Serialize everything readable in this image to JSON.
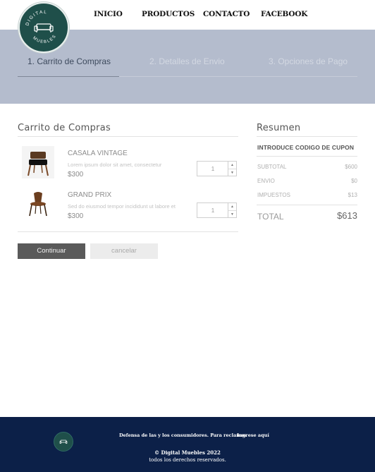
{
  "brand": {
    "logo_text_top": "DIGITAL",
    "logo_text_right": "MUEBLES",
    "logo_text_bottom": "MUEBLES",
    "logo_color": "#1f4f4a"
  },
  "nav": {
    "items": [
      "INICIO",
      "PRODUCTOS",
      "CONTACTO",
      "FACEBOOK"
    ]
  },
  "steps": {
    "items": [
      "1. Carrito de Compras",
      "2. Detalles de Envio",
      "3. Opciones de Pago"
    ],
    "active_index": 0,
    "band_color": "#b4bccd"
  },
  "cart": {
    "title": "Carrito de Compras",
    "items": [
      {
        "name": "CASALA VINTAGE",
        "desc": "Lorem ipsum dolor sit amet, consectetur",
        "price": "$300",
        "qty": "1",
        "icon": "chair-image"
      },
      {
        "name": "GRAND PRIX",
        "desc": "Sed do eiusmod tempor incididunt ut labore et",
        "price": "$300",
        "qty": "1",
        "icon": "chair-image"
      }
    ],
    "continue_label": "Continuar",
    "cancel_label": "cancelar"
  },
  "summary": {
    "title": "Resumen",
    "coupon_label": "INTRODUCE CODIGO DE CUPON",
    "rows": [
      {
        "label": "SUBTOTAL",
        "value": "$600"
      },
      {
        "label": "ENVIO",
        "value": "$0"
      },
      {
        "label": "IMPUESTOS",
        "value": "$13"
      }
    ],
    "total_label": "TOTAL",
    "total_value": "$613"
  },
  "footer": {
    "consumer_text": "Defensa de las y los consumidores. Para reclamos",
    "consumer_link": "Ingrese aquí",
    "copyright": "© Digital Muebles 2022",
    "rights": "todos los derechos reservados.",
    "background_color": "#0c2048"
  }
}
